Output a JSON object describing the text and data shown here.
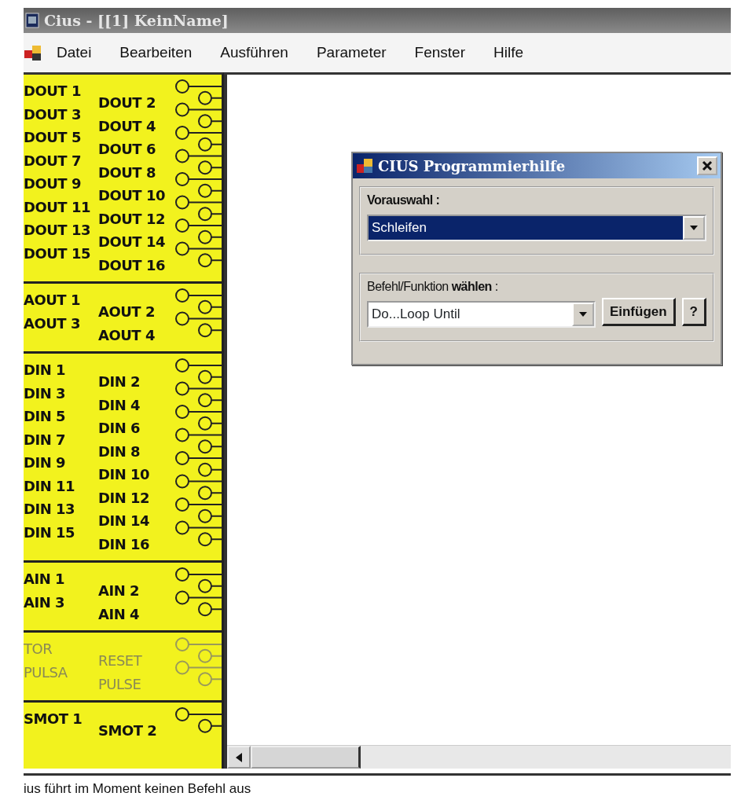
{
  "window": {
    "title": "Cius - [[1] KeinName]"
  },
  "menu": [
    {
      "label": "Datei"
    },
    {
      "label": "Bearbeiten"
    },
    {
      "label": "Ausführen"
    },
    {
      "label": "Parameter"
    },
    {
      "label": "Fenster"
    },
    {
      "label": "Hilfe"
    }
  ],
  "io_panel": {
    "sections": [
      {
        "disabled": false,
        "left": [
          "DOUT 1",
          "DOUT 3",
          "DOUT 5",
          "DOUT 7",
          "DOUT 9",
          "DOUT 11",
          "DOUT 13",
          "DOUT 15"
        ],
        "right": [
          "DOUT 2",
          "DOUT 4",
          "DOUT 6",
          "DOUT 8",
          "DOUT 10",
          "DOUT 12",
          "DOUT 14",
          "DOUT 16"
        ]
      },
      {
        "disabled": false,
        "left": [
          "AOUT 1",
          "AOUT 3"
        ],
        "right": [
          "AOUT 2",
          "AOUT 4"
        ]
      },
      {
        "disabled": false,
        "left": [
          "DIN 1",
          "DIN 3",
          "DIN 5",
          "DIN 7",
          "DIN 9",
          "DIN 11",
          "DIN 13",
          "DIN 15"
        ],
        "right": [
          "DIN 2",
          "DIN 4",
          "DIN 6",
          "DIN 8",
          "DIN 10",
          "DIN 12",
          "DIN 14",
          "DIN 16"
        ]
      },
      {
        "disabled": false,
        "left": [
          "AIN 1",
          "AIN 3"
        ],
        "right": [
          "AIN 2",
          "AIN 4"
        ]
      },
      {
        "disabled": true,
        "left": [
          "TOR",
          "PULSA"
        ],
        "right": [
          "RESET",
          "PULSE"
        ]
      },
      {
        "disabled": false,
        "left": [
          "SMOT 1"
        ],
        "right": [
          "SMOT 2"
        ]
      }
    ]
  },
  "dialog": {
    "title": "CIUS Programmierhilfe",
    "preselect": {
      "label": "Vorauswahl :",
      "value": "Schleifen",
      "selected": true
    },
    "command": {
      "label": "Befehl/Funktion **wählen** :",
      "value": "Do...Loop Until",
      "selected": false
    },
    "buttons": [
      "Einfügen",
      "?"
    ]
  },
  "status_bar": {
    "text": "ius führt im Moment keinen Befehl aus"
  }
}
